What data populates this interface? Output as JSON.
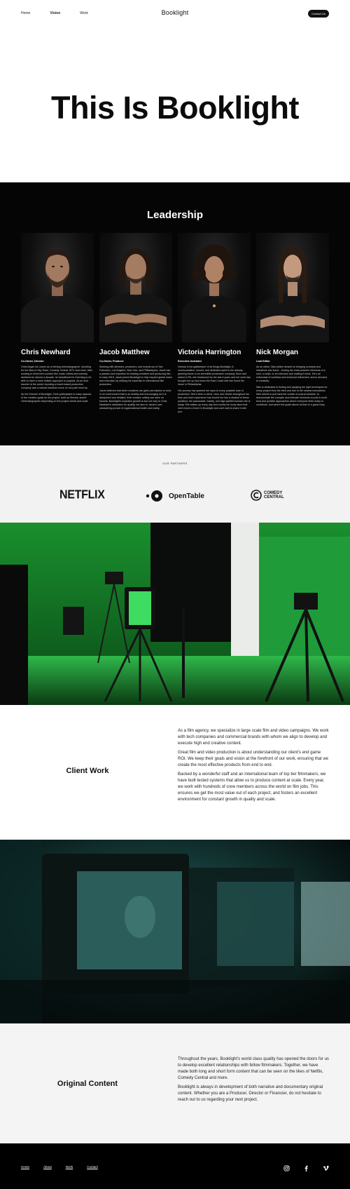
{
  "nav": {
    "links": [
      {
        "label": "Home"
      },
      {
        "label": "Vision"
      },
      {
        "label": "Work"
      }
    ],
    "brand": "Booklight",
    "contact_label": "Contact Us"
  },
  "hero": {
    "title": "This Is Booklight"
  },
  "leadership": {
    "title": "Leadership",
    "members": [
      {
        "name": "Chris Newhard",
        "role": "Co-Owner, Director",
        "bio": [
          "Chris began his career as a thriving cinematographer, shooting for the likes of Sky Team, Comedy Central, MTV and more. After working in short-form content like music videos and comedy sketches for almost a decade, he transitioned to Directing to be able to have a more holistic approach to projects. As an avid traveler of the world, founding a travel-based production company was a natural business move on his point went by.",
          "As the Director of Booklight, Chris participates in many aspects of the creative goals for the project, both as Director and/or Cinematographer depending on the project needs and scale."
        ]
      },
      {
        "name": "Jacob Matthew",
        "role": "Co-Owner, Producer",
        "bio": [
          "Working with directors, producers, and brands out of San Francisco, Los Angeles, New York, and Philadelphia, Jacob has a passion and expertise for leading creatives and producing film. In early 2015, Jacob joined Booklight to help expand global reach and execution by utilizing his expertise in international film production.",
          "Jacob believes that when creatives are given permission to work in an environment that is as healthy and encouraging as it is disciplined and detailed, their creative ceiling can have no bounds. Booklight's explosive growth is due not only to Chris Newhard's obsession for quality, but also to Jacob's own unwavering pursuit of organizational health and clarity."
        ]
      },
      {
        "name": "Victoria Harrington",
        "role": "Executive Assistant",
        "bio": [
          "Victoria is the gatekeeper of all things Booklight. A communicative, honest, and dedicated spirit to the already growing frame of an incredible production company. Born and raised in PA, she freelanced for the last 6 years and her work has brought her up and down the East Coast until she found her home in Philadelphia.",
          "Her journey has sparked her eyes to every possible lane of production. She's been a client, crew, and viewer throughout her time and each experience has turned her into a student of these positions, the passionate, bubbly, and high-spirited woman she is today. She wakes up every day and counts her lucky stars that she's found a home in Booklight and can't wait to share it with you."
        ]
      },
      {
        "name": "Nick Morgan",
        "role": "Lead Editor",
        "bio": [
          "As an editor, Nick prides himself on bringing concepts and narratives into focus – finding the most powerful elements of a shot, a script, or an interview and making it shine. He's an enthusiast of workflow and technical refinement, and is devoted to creativity.",
          "Nick is dedicated to finding and applying the right techniques for every project from the tried and true to the newest innovations. Nick strives to pull back the curtain of post-production, to demonstrate the complex and intricate elements of post to build trust and positive approaches where everyone feels ready to contribute, and where the goals above all else is a great story."
        ]
      }
    ]
  },
  "partners": {
    "label": "OUR PARTNERS",
    "logos": [
      {
        "name": "NETFLIX"
      },
      {
        "name": "OpenTable"
      },
      {
        "name_line1": "COMEDY",
        "name_line2": "CENTRAL"
      }
    ]
  },
  "client_work": {
    "title": "Client Work",
    "paragraphs": [
      "As a film agency, we specialize in large scale film and video campaigns. We work with tech companies and commercial brands with whom we align to develop and execute high end creative content.",
      "Great film and video production is about understanding our client's end game ROI. We keep their goals and vision at the forefront of our work, ensuring that we create the most effective products from end to end.",
      "Backed by a wonderful staff and an international team of top tier filmmakers, we have built tested systems that allow us to produce content at scale. Every year, we work with hundreds of crew members across the world on film jobs. This ensures we get the most value out of each project, and fosters an excellent environment for constant growth in quality and scale."
    ]
  },
  "original_content": {
    "title": "Original Content",
    "paragraphs": [
      "Throughout the years, Booklight's world class quality has opened the doors for us to develop excellent relationships with fellow filmmakers. Together, we have made both long and short form content that can be seen on the likes of Netflix, Comedy Central and more.",
      "Booklight is always in development of both narrative and documentary original content.  Whether you are a Producer, Director or Financier, do not hesitate to reach out to us regarding your next project."
    ]
  },
  "footer": {
    "links": [
      {
        "label": "Home"
      },
      {
        "label": "About"
      },
      {
        "label": "Work"
      },
      {
        "label": "Contact"
      }
    ],
    "socials": [
      {
        "icon": "instagram-icon"
      },
      {
        "icon": "facebook-icon"
      },
      {
        "icon": "vimeo-icon"
      }
    ]
  },
  "colors": {
    "dark_bg": "#050505",
    "partners_bg": "#f2f2f2",
    "green_screen": "#1fa83a",
    "teal_shadow": "#0f4a47"
  }
}
